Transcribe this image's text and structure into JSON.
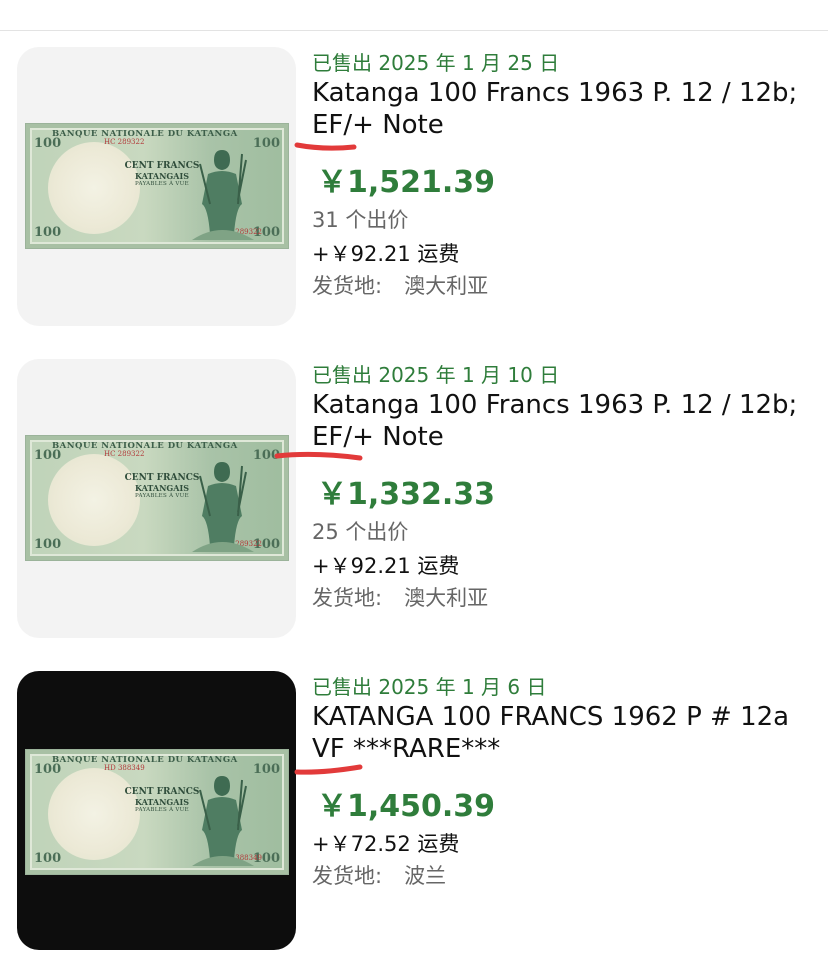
{
  "note_art": {
    "bank_name": "BANQUE NATIONALE DU KATANGA",
    "denomination": "100",
    "line1": "CENT FRANCS",
    "line2": "KATANGAIS",
    "line3": "PAYABLES À VUE",
    "serial_a": "HC 289322",
    "serial_b": "HD 388349"
  },
  "colors": {
    "accent_green": "#2f7d3b",
    "underline_red": "#e23a3a",
    "muted_text": "#666666"
  },
  "listings": [
    {
      "sold_date": "已售出 2025 年 1 月 25 日",
      "title_line1": "Katanga 100 Francs 1963 P. 12 / 12b;",
      "title_line2": "EF/+ Note",
      "price": "￥1,521.39",
      "bids": "31 个出价",
      "shipping": "+￥92.21 运费",
      "location_label": "发货地:",
      "location_value": "澳大利亚",
      "serial": "HC 289322"
    },
    {
      "sold_date": "已售出 2025 年 1 月 10 日",
      "title_line1": "Katanga 100 Francs 1963 P. 12 / 12b;",
      "title_line2": "EF/+ Note",
      "price": "￥1,332.33",
      "bids": "25 个出价",
      "shipping": "+￥92.21 运费",
      "location_label": "发货地:",
      "location_value": "澳大利亚",
      "serial": "HC 289322"
    },
    {
      "sold_date": "已售出 2025 年 1 月 6 日",
      "title_line1": "KATANGA 100 FRANCS 1962 P # 12a",
      "title_line2": "VF ***RARE***",
      "price": "￥1,450.39",
      "shipping": "+￥72.52 运费",
      "location_label": "发货地:",
      "location_value": "波兰",
      "serial": "HD 388349"
    }
  ]
}
